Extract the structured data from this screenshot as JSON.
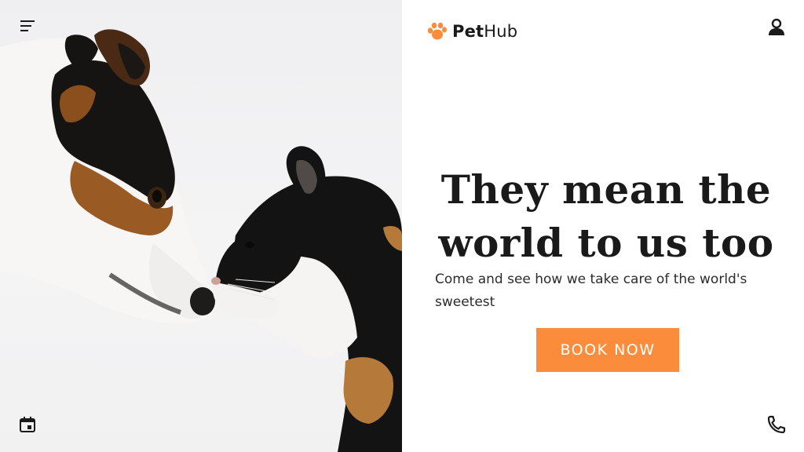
{
  "nav": {
    "menu_icon": "menu-icon",
    "calendar_icon": "calendar-icon",
    "account_icon": "user-icon",
    "phone_icon": "phone-icon"
  },
  "brand": {
    "name_bold": "Pet",
    "name_regular": "Hub",
    "logo_icon": "paw-icon",
    "accent_color": "#fb8c3c"
  },
  "hero": {
    "headline": "They mean the world to us too",
    "subtext": "Come and see how we take care of the world's sweetest",
    "cta_label": "BOOK NOW"
  }
}
